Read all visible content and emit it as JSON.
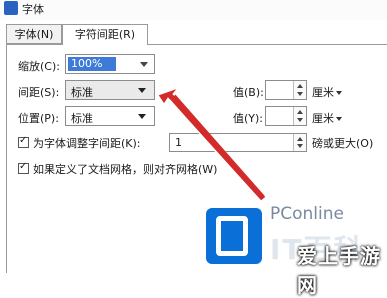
{
  "window": {
    "title": "字体"
  },
  "tabs": [
    {
      "label": "字体(N)"
    },
    {
      "label": "字符间距(R)"
    }
  ],
  "fields": {
    "scale": {
      "label": "缩放(C):",
      "value": "100%"
    },
    "spacing": {
      "label": "间距(S):",
      "value": "标准",
      "by_label": "值(B):",
      "unit": "厘米"
    },
    "position": {
      "label": "位置(P):",
      "value": "标准",
      "by_label": "值(Y):",
      "unit": "厘米"
    },
    "kerning": {
      "label": "为字体调整字间距(K):",
      "value": "1",
      "suffix": "磅或更大(O)",
      "checked": true
    },
    "grid": {
      "label": "如果定义了文档网格，则对齐网格(W)",
      "checked": true
    }
  },
  "watermark": {
    "brand": "PConline",
    "big": "IT百科",
    "cn": "爱上手游网"
  },
  "colors": {
    "arrow": "#d32a2a",
    "selection": "#3e7ad8",
    "logo": "#0a6fd6"
  }
}
